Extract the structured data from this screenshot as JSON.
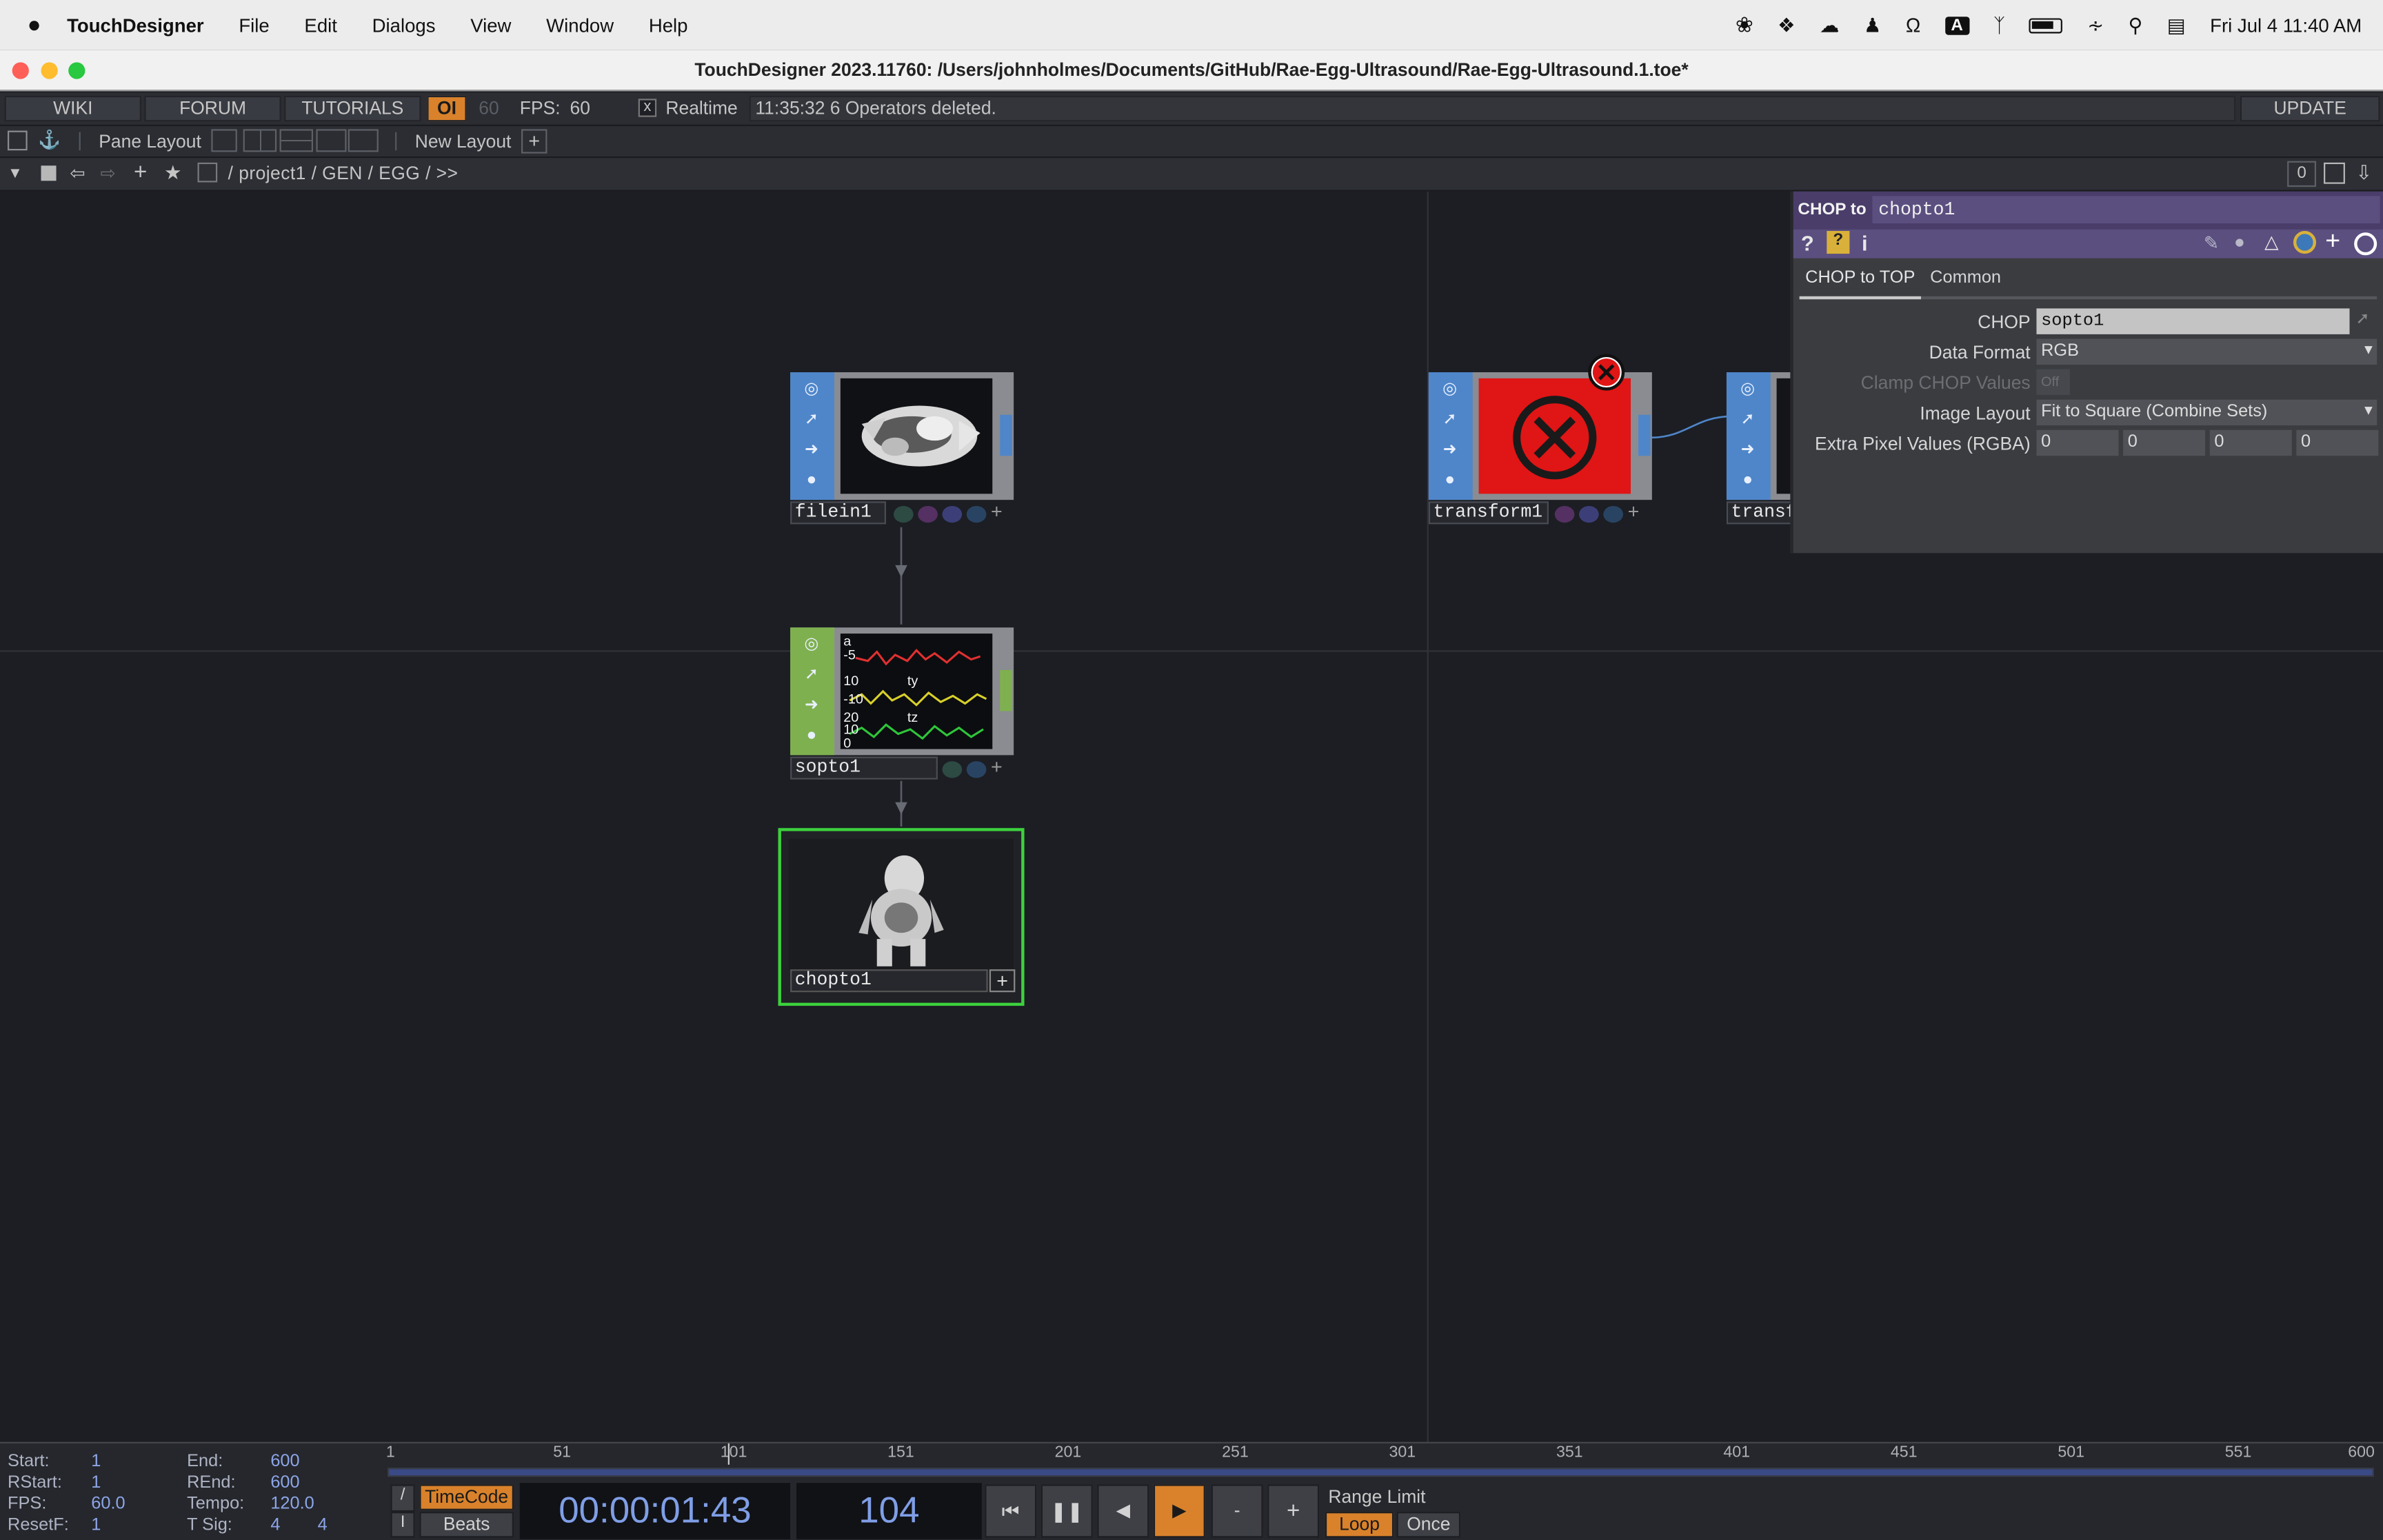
{
  "menubar": {
    "app_name": "TouchDesigner",
    "items": [
      "File",
      "Edit",
      "Dialogs",
      "View",
      "Window",
      "Help"
    ],
    "clock": "Fri Jul 4  11:40 AM",
    "input_source": "A"
  },
  "window": {
    "title": "TouchDesigner 2023.11760: /Users/johnholmes/Documents/GitHub/Rae-Egg-Ultrasound/Rae-Egg-Ultrasound.1.toe*"
  },
  "toolbar1": {
    "wiki": "WIKI",
    "forum": "FORUM",
    "tutorials": "TUTORIALS",
    "oi": "OI",
    "fps_target": "60",
    "fps_label": "FPS:",
    "fps_value": "60",
    "realtime_check": "x",
    "realtime": "Realtime",
    "status_message": "11:35:32 6 Operators deleted.",
    "update": "UPDATE"
  },
  "toolbar2": {
    "pane_layout": "Pane Layout",
    "new_layout": "New Layout",
    "add": "+"
  },
  "toolbar3": {
    "path": "/ project1 / GEN / EGG / >>",
    "counter": "0"
  },
  "nodes": {
    "filein1": "filein1",
    "sopto1": "sopto1",
    "sopto_labels": [
      "a",
      "-5",
      "10",
      "ty",
      "-10",
      "20",
      "tz",
      "10",
      "0"
    ],
    "chopto1": "chopto1",
    "transform1": "transform1",
    "transform2": "transf"
  },
  "params": {
    "header_type": "CHOP to",
    "header_name": "chopto1",
    "tabs": [
      "CHOP to TOP",
      "Common"
    ],
    "rows": [
      {
        "label": "CHOP",
        "value": "sopto1"
      },
      {
        "label": "Data Format",
        "value": "RGB"
      },
      {
        "label": "Clamp CHOP Values",
        "value": "Off"
      },
      {
        "label": "Image Layout",
        "value": "Fit to Square (Combine Sets)"
      },
      {
        "label": "Extra Pixel Values (RGBA)",
        "values": [
          "0",
          "0",
          "0",
          "0"
        ]
      }
    ]
  },
  "timeline": {
    "labels": {
      "start": "Start:",
      "rstart": "RStart:",
      "fps": "FPS:",
      "resetf": "ResetF:",
      "end": "End:",
      "rend": "REnd:",
      "tempo": "Tempo:",
      "tsig": "T Sig:"
    },
    "values": {
      "start": "1",
      "rstart": "1",
      "fps": "60.0",
      "resetf": "1",
      "end": "600",
      "rend": "600",
      "tempo": "120.0",
      "tsig_a": "4",
      "tsig_b": "4"
    },
    "ticks": [
      "1",
      "51",
      "101",
      "151",
      "201",
      "251",
      "301",
      "351",
      "401",
      "451",
      "501",
      "551",
      "600"
    ],
    "timecode_label": "TimeCode",
    "beats_label": "Beats",
    "timecode": "00:00:01:43",
    "frame": "104",
    "range_limit": "Range Limit",
    "loop": "Loop",
    "once": "Once",
    "minus": "-",
    "plus": "+"
  },
  "colors": {
    "accent_orange": "#d9822b",
    "node_blue": "#4f86c9",
    "node_green": "#7fb04f",
    "error_red": "#e01515",
    "selected_green": "#3dd13d"
  }
}
